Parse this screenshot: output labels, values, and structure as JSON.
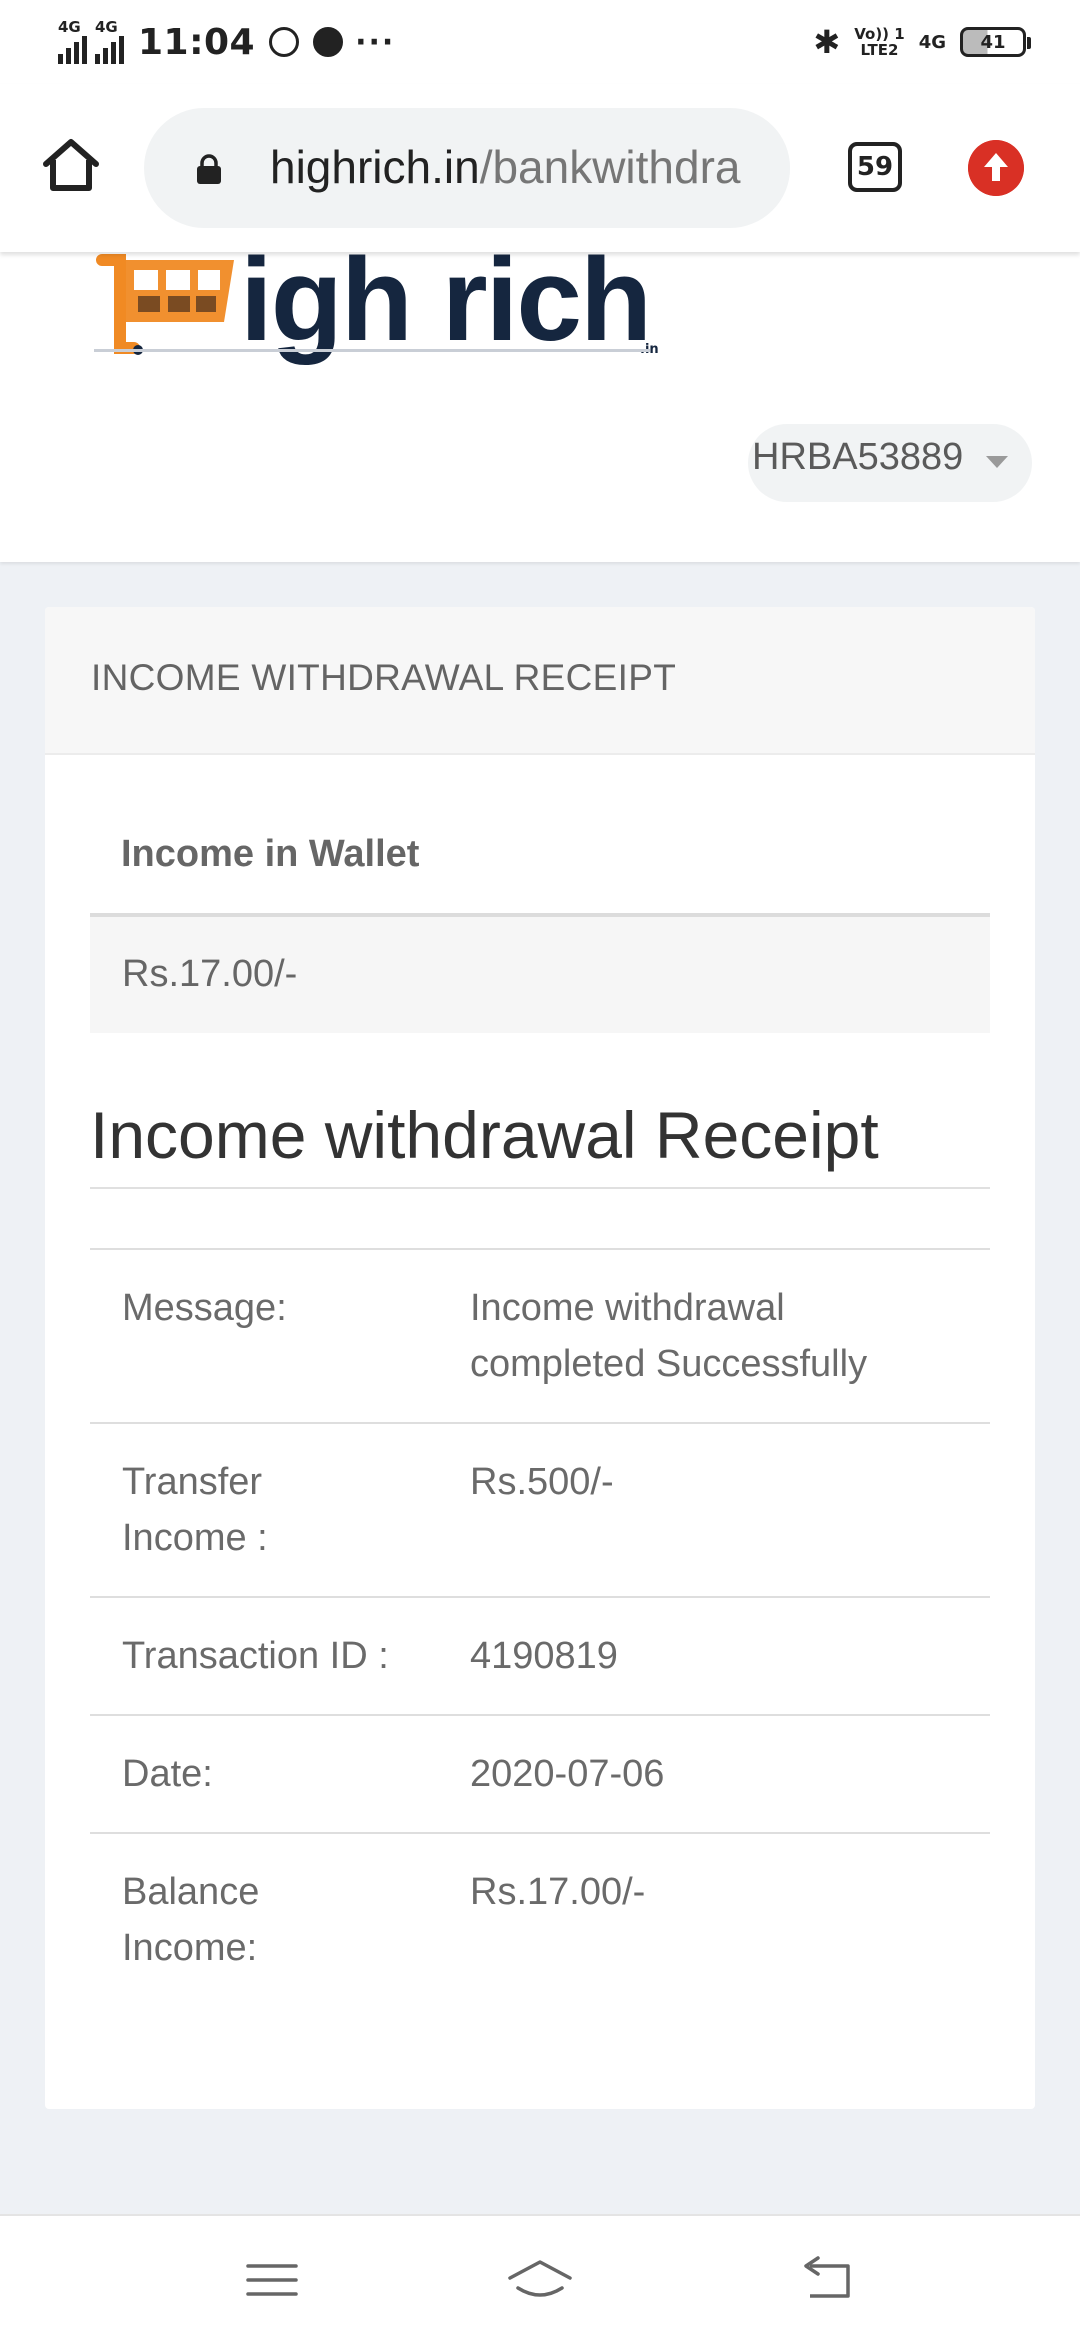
{
  "status_bar": {
    "signal1_label": "4G",
    "signal2_label": "4G",
    "time": "11:04",
    "more": "···",
    "volte_label": "Vo)) 1\nLTE2",
    "network_label": "4G",
    "battery_level": "41"
  },
  "browser": {
    "url_domain": "highrich.in",
    "url_path": "/bankwithdra",
    "tab_count": "59",
    "icons": [
      "home-icon",
      "lock-icon",
      "tabs-icon",
      "update-icon"
    ]
  },
  "header": {
    "logo_text": "igh rich",
    "logo_suffix": ".in",
    "user_id": "HRBA53889"
  },
  "card": {
    "title": "INCOME WITHDRAWAL RECEIPT",
    "wallet_heading": "Income in Wallet",
    "wallet_value": "Rs.17.00/-",
    "receipt_heading": "Income withdrawal Receipt",
    "rows": [
      {
        "label": "Message:",
        "value": "Income withdrawal completed Successfully"
      },
      {
        "label": "Transfer Income :",
        "value": "Rs.500/-"
      },
      {
        "label": "Transaction ID :",
        "value": "4190819"
      },
      {
        "label": "Date:",
        "value": "2020-07-06"
      },
      {
        "label": "Balance Income:",
        "value": "Rs.17.00/-"
      }
    ]
  },
  "navbar": {
    "icons": [
      "menu-icon",
      "home-nav-icon",
      "back-icon"
    ]
  },
  "colors": {
    "logo_navy": "#15263f",
    "logo_orange": "#f08a24",
    "update_red": "#d93025"
  }
}
